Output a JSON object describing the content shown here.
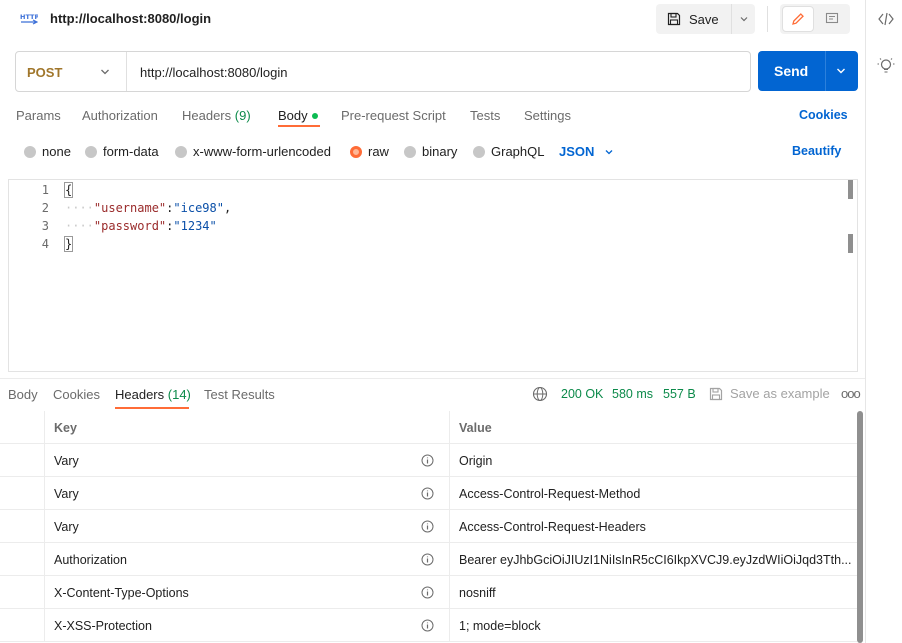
{
  "request": {
    "title": "http://localhost:8080/login",
    "save_label": "Save",
    "method": "POST",
    "url": "http://localhost:8080/login",
    "send_label": "Send"
  },
  "request_tabs": [
    {
      "label": "Params"
    },
    {
      "label": "Authorization"
    },
    {
      "label": "Headers",
      "count": "(9)"
    },
    {
      "label": "Body",
      "active": true
    },
    {
      "label": "Pre-request Script"
    },
    {
      "label": "Tests"
    },
    {
      "label": "Settings"
    }
  ],
  "cookies_label": "Cookies",
  "body_types": [
    {
      "label": "none"
    },
    {
      "label": "form-data"
    },
    {
      "label": "x-www-form-urlencoded"
    },
    {
      "label": "raw",
      "selected": true
    },
    {
      "label": "binary"
    },
    {
      "label": "GraphQL"
    }
  ],
  "raw_format": "JSON",
  "beautify_label": "Beautify",
  "editor": {
    "line_numbers": [
      "1",
      "2",
      "3",
      "4"
    ],
    "lines": [
      {
        "open": "{"
      },
      {
        "key": "\"username\"",
        "colon": ":",
        "value": "\"ice98\"",
        "comma": ","
      },
      {
        "key": "\"password\"",
        "colon": ":",
        "value": "\"1234\""
      },
      {
        "close": "}"
      }
    ]
  },
  "response": {
    "tabs": [
      {
        "label": "Body"
      },
      {
        "label": "Cookies"
      },
      {
        "label": "Headers",
        "count": "(14)",
        "active": true
      },
      {
        "label": "Test Results"
      }
    ],
    "status": "200 OK",
    "time": "580 ms",
    "size": "557 B",
    "save_example_label": "Save as example",
    "more_label": "ooo"
  },
  "headers_table": {
    "columns": [
      "Key",
      "Value"
    ],
    "rows": [
      {
        "key": "Vary",
        "value": "Origin"
      },
      {
        "key": "Vary",
        "value": "Access-Control-Request-Method"
      },
      {
        "key": "Vary",
        "value": "Access-Control-Request-Headers"
      },
      {
        "key": "Authorization",
        "value": "Bearer eyJhbGciOiJIUzI1NiIsInR5cCI6IkpXVCJ9.eyJzdWIiOiJqd3Tth..."
      },
      {
        "key": "X-Content-Type-Options",
        "value": "nosniff"
      },
      {
        "key": "X-XSS-Protection",
        "value": "1; mode=block"
      }
    ]
  },
  "colors": {
    "accent": "#ff6c37",
    "send": "#0265d2",
    "link": "#0265d2",
    "method": "#a0762b",
    "status_ok": "#0c8a4a"
  }
}
